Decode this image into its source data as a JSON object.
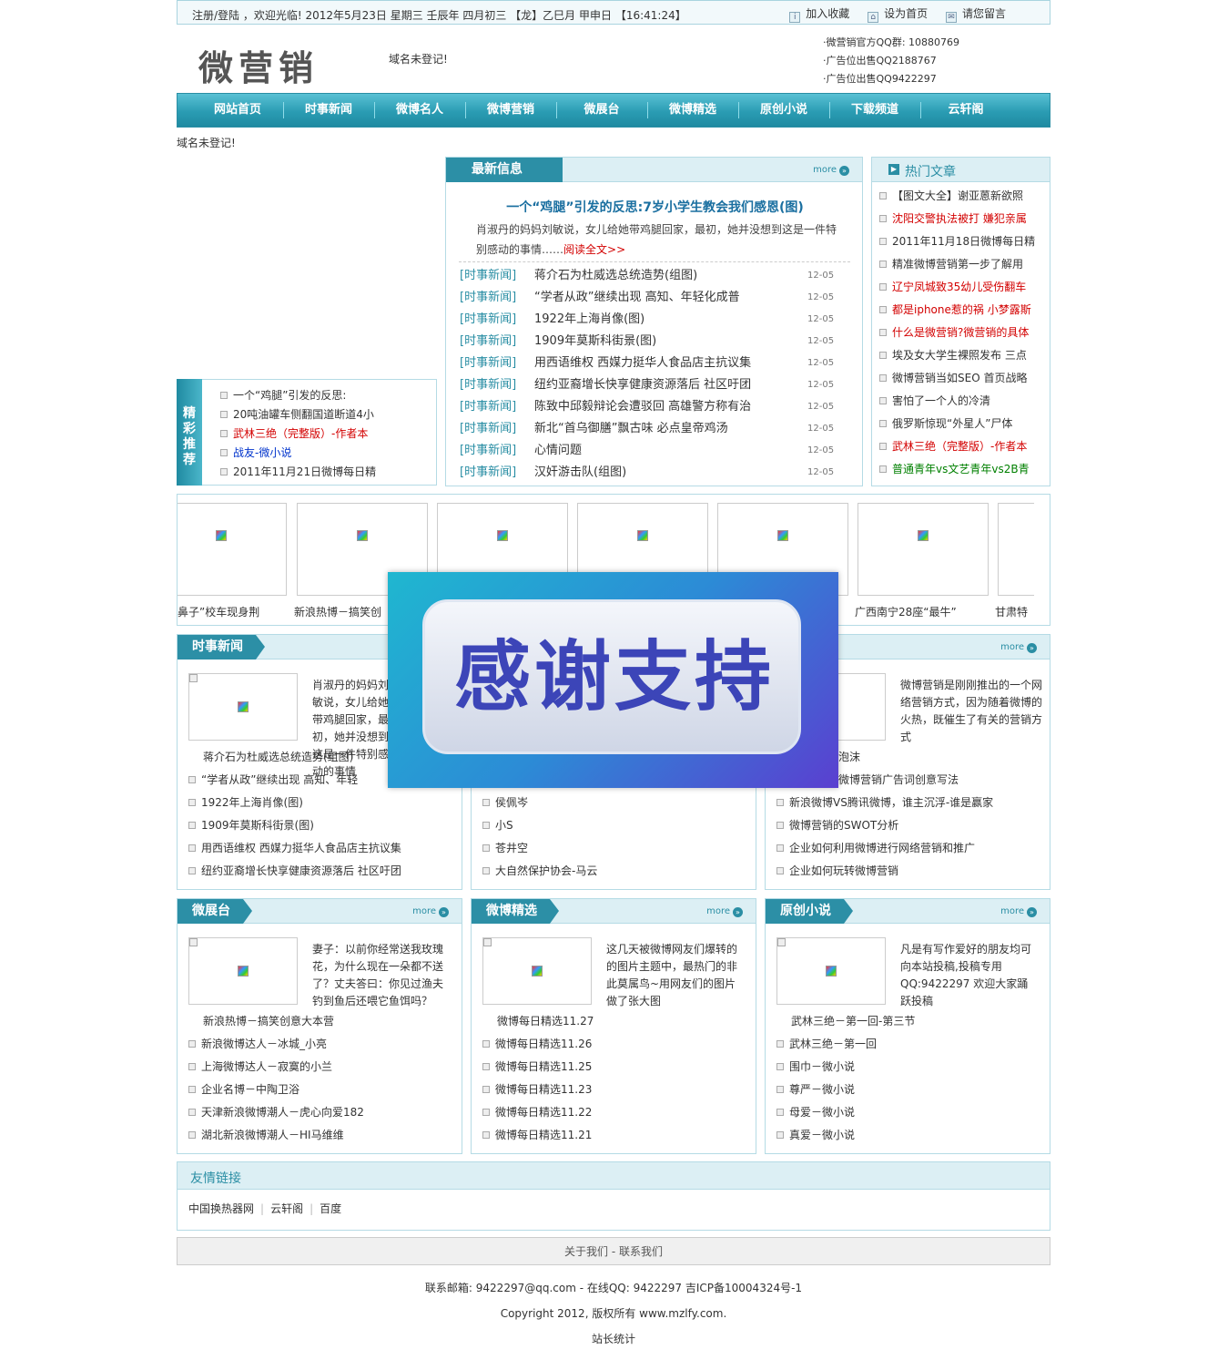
{
  "topbar": {
    "greeting": "注册/登陆 ，欢迎光临! 2012年5月23日 星期三  壬辰年 四月初三 【龙】乙巳月 甲申日 【16:41:24】",
    "favorite": "加入收藏",
    "homepage": "设为首页",
    "message": "请您留言"
  },
  "header": {
    "logo": "微营销",
    "domain_notice": "域名未登记!",
    "qq_lines": [
      "·微营销官方QQ群: 10880769",
      "·广告位出售QQ2188767",
      "·广告位出售QQ9422297"
    ]
  },
  "nav": [
    "网站首页",
    "时事新闻",
    "微博名人",
    "微博营销",
    "微展台",
    "微博精选",
    "原创小说",
    "下载频道",
    "云轩阁"
  ],
  "domain_notice2": "域名未登记!",
  "recommend": {
    "tab": "精彩推荐",
    "items": [
      {
        "text": "一个“鸡腿”引发的反思:",
        "color": ""
      },
      {
        "text": "20吨油罐车侧翻国道断道4小",
        "color": ""
      },
      {
        "text": "武林三绝（完整版）-作者本",
        "color": "red"
      },
      {
        "text": "战友-微小说",
        "color": "blue"
      },
      {
        "text": "2011年11月21日微博每日精",
        "color": ""
      }
    ]
  },
  "latest": {
    "title": "最新信息",
    "more": "more",
    "headline": "一个“鸡腿”引发的反思:7岁小学生教会我们感恩(图)",
    "summary_1": "肖淑丹的妈妈刘敏说，女儿给她带鸡腿回家，最初，她并没想到这是一件特",
    "summary_2": "别感动的事情……",
    "read_more": "阅读全文>>",
    "items": [
      {
        "cat": "[时事新闻]",
        "title": "蒋介石为杜威选总统造势(组图)",
        "date": "12-05"
      },
      {
        "cat": "[时事新闻]",
        "title": "“学者从政”继续出现 高知、年轻化成普",
        "date": "12-05"
      },
      {
        "cat": "[时事新闻]",
        "title": "1922年上海肖像(图)",
        "date": "12-05"
      },
      {
        "cat": "[时事新闻]",
        "title": "1909年莫斯科街景(图)",
        "date": "12-05"
      },
      {
        "cat": "[时事新闻]",
        "title": "用西语维权 西媒力挺华人食品店主抗议集",
        "date": "12-05"
      },
      {
        "cat": "[时事新闻]",
        "title": "纽约亚裔增长快享健康资源落后 社区吁团",
        "date": "12-05"
      },
      {
        "cat": "[时事新闻]",
        "title": "陈致中邱毅辩论会遭驳回 高雄警方称有治",
        "date": "12-05"
      },
      {
        "cat": "[时事新闻]",
        "title": "新北“首乌御膳”飘古味 必点皇帝鸡汤",
        "date": "12-05"
      },
      {
        "cat": "[时事新闻]",
        "title": "心情问题",
        "date": "12-05"
      },
      {
        "cat": "[时事新闻]",
        "title": "汉奸游击队(组图)",
        "date": "12-05"
      }
    ]
  },
  "hot": {
    "title": "热门文章",
    "items": [
      {
        "text": "【图文大全】谢亚蒽新欲照",
        "color": ""
      },
      {
        "text": "沈阳交警执法被打 嫌犯亲属",
        "color": "red"
      },
      {
        "text": "2011年11月18日微博每日精",
        "color": ""
      },
      {
        "text": "精准微博营销第一步了解用",
        "color": ""
      },
      {
        "text": "辽宁凤城致35幼儿受伤翻车",
        "color": "red"
      },
      {
        "text": "都是iphone惹的祸 小梦露斯",
        "color": "red"
      },
      {
        "text": "什么是微营销?微营销的具体",
        "color": "red"
      },
      {
        "text": "埃及女大学生裸照发布 三点",
        "color": ""
      },
      {
        "text": "微博营销当如SEO 首页战略",
        "color": ""
      },
      {
        "text": "害怕了一个人的冷清",
        "color": ""
      },
      {
        "text": "俄罗斯惊现“外星人”尸体",
        "color": ""
      },
      {
        "text": "武林三绝（完整版）-作者本",
        "color": "red"
      },
      {
        "text": "普通青年vs文艺青年vs2B青",
        "color": "green"
      }
    ]
  },
  "carousel": {
    "captions": [
      "鼻子”校车现身荆",
      "新浪热博－搞笑创",
      "",
      "",
      "",
      "广西南宁28座“最牛”",
      "甘肃特"
    ]
  },
  "sections": [
    {
      "title": "时事新闻",
      "more": "more",
      "desc": "肖淑丹的妈妈刘敏说，女儿给她带鸡腿回家，最初，她并没想到这是一件特别感动的事情",
      "items": [
        "蒋介石为杜威选总统造势(组图)",
        "“学者从政”继续出现 高知、年轻",
        "1922年上海肖像(图)",
        "1909年莫斯科街景(图)",
        "用西语维权 西媒力挺华人食品店主抗议集",
        "纽约亚裔增长快享健康资源落后 社区吁团"
      ]
    },
    {
      "title": "",
      "more": "",
      "desc": "",
      "items": [
        "",
        "",
        "侯佩岑",
        "小S",
        "苍井空",
        "大自然保护协会-马云"
      ]
    },
    {
      "title": "",
      "more": "more",
      "desc": "微博营销是刚刚推出的一个网络营销方式，因为随着微博的火热，既催生了有关的营销方式",
      "items": [
        "泡沫",
        "微博营销广告词创意写法",
        "新浪微博VS腾讯微博，谁主沉浮-谁是赢家",
        "微博营销的SWOT分析",
        "企业如何利用微博进行网络营销和推广",
        "企业如何玩转微博营销"
      ]
    },
    {
      "title": "微展台",
      "more": "more",
      "desc": "妻子：以前你经常送我玫瑰花，为什么现在一朵都不送了？丈夫答曰：你见过渔夫钓到鱼后还喂它鱼饵吗？",
      "items": [
        "新浪热博－搞笑创意大本营",
        "新浪微博达人－冰城_小亮",
        "上海微博达人－寂寞的小兰",
        "企业名博－中陶卫浴",
        "天津新浪微博潮人－虎心向爱182",
        "湖北新浪微博潮人－HI马维维"
      ]
    },
    {
      "title": "微博精选",
      "more": "more",
      "desc": "这几天被微博网友们爆转的的图片主题中，最热门的非此莫属鸟~用网友们的图片做了张大图",
      "items": [
        "微博每日精选11.27",
        "微博每日精选11.26",
        "微博每日精选11.25",
        "微博每日精选11.23",
        "微博每日精选11.22",
        "微博每日精选11.21"
      ]
    },
    {
      "title": "原创小说",
      "more": "more",
      "desc": "凡是有写作爱好的朋友均可向本站投稿,投稿专用QQ:9422297 欢迎大家踊跃投稿",
      "items": [
        "武林三绝－第一回-第三节",
        "武林三绝－第一回",
        "围巾－微小说",
        "尊严－微小说",
        "母爱－微小说",
        "真爱－微小说"
      ]
    }
  ],
  "overlay": {
    "text": "感谢支持"
  },
  "links": {
    "title": "友情链接",
    "items": [
      "中国换热器网",
      "云轩阁",
      "百度"
    ]
  },
  "footer": {
    "nav": "关于我们 - 联系我们",
    "contact": "联系邮箱: 9422297@qq.com - 在线QQ: 9422297 吉ICP备10004324号-1",
    "copyright": "Copyright 2012, 版权所有 www.mzlfy.com.",
    "stats": "站长统计"
  },
  "colors": {
    "accent": "#2c8fa6",
    "header_bg": "#dceff4",
    "border": "#b5dbe5",
    "red": "#d30000"
  }
}
